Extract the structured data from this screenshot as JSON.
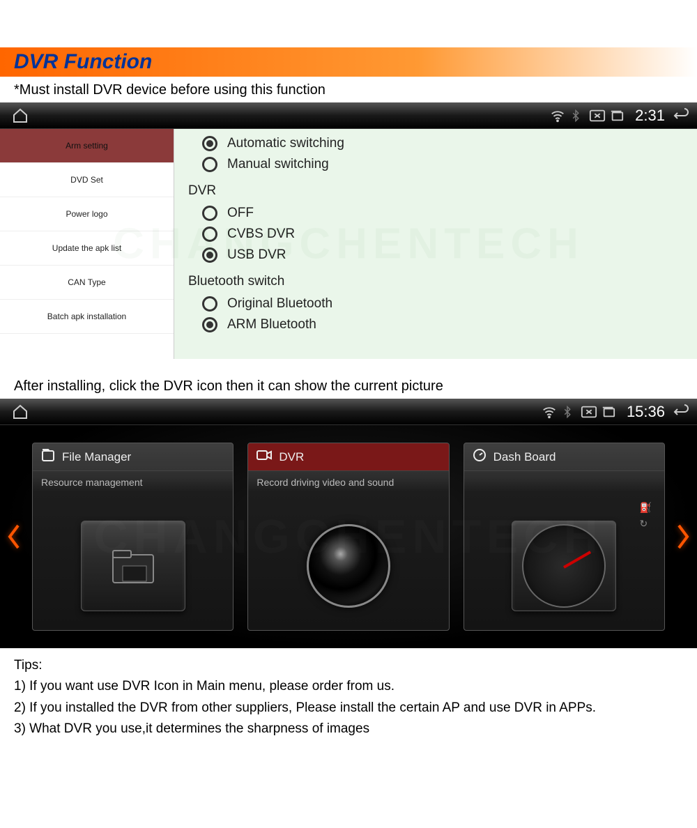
{
  "page": {
    "title": "DVR Function",
    "note_before_settings": "*Must install DVR device before using this function",
    "note_after_settings": "After installing, click the DVR icon then it can show the current picture",
    "watermark": "CHANGCHENTECH"
  },
  "status1": {
    "time": "2:31"
  },
  "status2": {
    "time": "15:36"
  },
  "sidebar": {
    "items": [
      {
        "label": "Arm setting",
        "active": true
      },
      {
        "label": "DVD Set"
      },
      {
        "label": "Power logo"
      },
      {
        "label": "Update the apk list"
      },
      {
        "label": "CAN Type"
      },
      {
        "label": "Batch apk installation"
      }
    ]
  },
  "settings": {
    "group1": [
      {
        "label": "Automatic switching",
        "selected": true
      },
      {
        "label": "Manual switching",
        "selected": false
      }
    ],
    "heading_dvr": "DVR",
    "group_dvr": [
      {
        "label": "OFF",
        "selected": false
      },
      {
        "label": "CVBS DVR",
        "selected": false
      },
      {
        "label": "USB DVR",
        "selected": true
      }
    ],
    "heading_bt": "Bluetooth switch",
    "group_bt": [
      {
        "label": "Original Bluetooth",
        "selected": false
      },
      {
        "label": "ARM Bluetooth",
        "selected": true
      }
    ]
  },
  "home_cards": [
    {
      "title": "File Manager",
      "subtitle": "Resource management",
      "icon": "folder",
      "selected": false
    },
    {
      "title": "DVR",
      "subtitle": "Record driving video and sound",
      "icon": "lens",
      "selected": true
    },
    {
      "title": "Dash Board",
      "subtitle": "",
      "icon": "gauge",
      "selected": false
    }
  ],
  "tips": {
    "heading": "Tips:",
    "items": [
      "1) If you want use DVR Icon in Main menu, please order from us.",
      "2) If you installed the DVR from other suppliers, Please install the certain AP and use DVR in APPs.",
      "3) What DVR you use,it determines the sharpness of images"
    ]
  }
}
